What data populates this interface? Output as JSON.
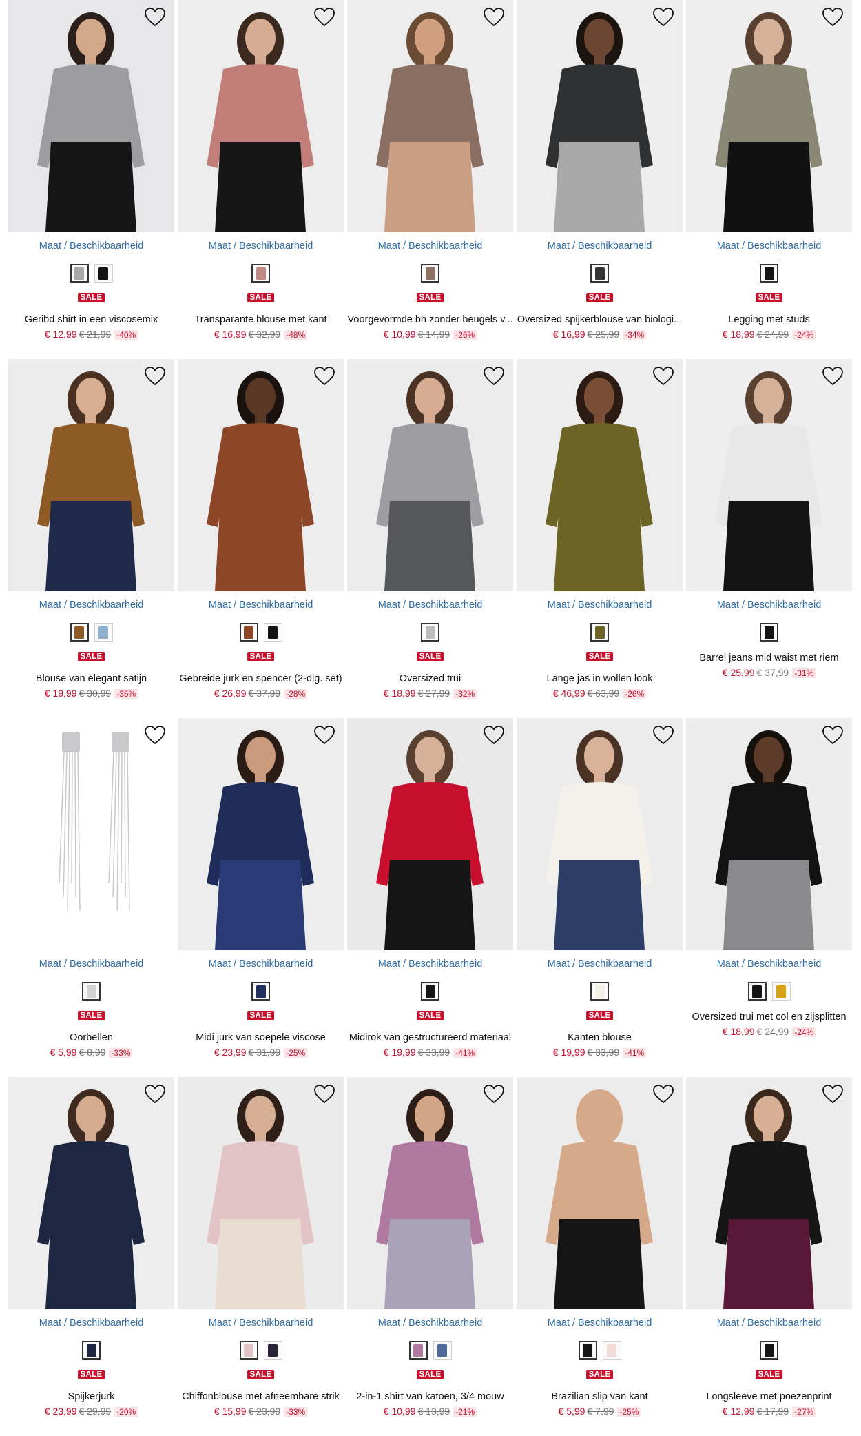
{
  "size_link_label": "Maat / Beschikbaarheid",
  "sale_label": "SALE",
  "products": [
    {
      "title": "Geribd shirt in een viscosemix",
      "price": "€ 12,99",
      "old_price": "€ 21,99",
      "discount": "-40%",
      "sale": true,
      "colors": {
        "bg": "#e7e7e9",
        "top": "#9d9da0",
        "bottom": "#151515",
        "skin": "#d2a88a",
        "hair": "#2a1f1a"
      },
      "swatches": [
        "#a9a9ab",
        "#141414"
      ]
    },
    {
      "title": "Transparante blouse met kant",
      "price": "€ 16,99",
      "old_price": "€ 32,99",
      "discount": "-48%",
      "sale": true,
      "colors": {
        "bg": "#ededed",
        "top": "#c27f7a",
        "bottom": "#161616",
        "skin": "#d6ad92",
        "hair": "#3b281e"
      },
      "swatches": [
        "#c38a83"
      ]
    },
    {
      "title": "Voorgevormde bh zonder beugels v...",
      "price": "€ 10,99",
      "old_price": "€ 14,99",
      "discount": "-26%",
      "sale": true,
      "colors": {
        "bg": "#ededed",
        "top": "#8b6e62",
        "bottom": "#c99e82",
        "skin": "#cf9f80",
        "hair": "#6a4a33"
      },
      "swatches": [
        "#8f7266"
      ]
    },
    {
      "title": "Oversized spijkerblouse van biologi...",
      "price": "€ 16,99",
      "old_price": "€ 25,99",
      "discount": "-34%",
      "sale": true,
      "colors": {
        "bg": "#ededed",
        "top": "#2f3032",
        "bottom": "#a8a8a8",
        "skin": "#6a4633",
        "hair": "#1c140f"
      },
      "swatches": [
        "#333436"
      ]
    },
    {
      "title": "Legging met studs",
      "price": "€ 18,99",
      "old_price": "€ 24,99",
      "discount": "-24%",
      "sale": true,
      "colors": {
        "bg": "#eeeeee",
        "top": "#8a8775",
        "bottom": "#111111",
        "skin": "#d6b199",
        "hair": "#5a4030"
      },
      "swatches": [
        "#151515"
      ]
    },
    {
      "title": "Blouse van elegant satijn",
      "price": "€ 19,99",
      "old_price": "€ 30,99",
      "discount": "-35%",
      "sale": true,
      "colors": {
        "bg": "#ececec",
        "top": "#8e5a26",
        "bottom": "#1f2a4a",
        "skin": "#d8ae92",
        "hair": "#4a3020"
      },
      "swatches": [
        "#8e5a26",
        "#8fb0cc"
      ]
    },
    {
      "title": "Gebreide jurk en spencer (2-dlg. set)",
      "price": "€ 26,99",
      "old_price": "€ 37,99",
      "discount": "-28%",
      "sale": true,
      "colors": {
        "bg": "#ededed",
        "top": "#8e4628",
        "bottom": "#8e4628",
        "skin": "#5a3826",
        "hair": "#1a120e"
      },
      "swatches": [
        "#8e4628",
        "#141414"
      ]
    },
    {
      "title": "Oversized trui",
      "price": "€ 18,99",
      "old_price": "€ 27,99",
      "discount": "-32%",
      "sale": true,
      "colors": {
        "bg": "#ececec",
        "top": "#9e9ea2",
        "bottom": "#55575a",
        "skin": "#d6ad92",
        "hair": "#4a3224"
      },
      "swatches": [
        "#bdbdbf"
      ]
    },
    {
      "title": "Lange jas in wollen look",
      "price": "€ 46,99",
      "old_price": "€ 63,99",
      "discount": "-26%",
      "sale": true,
      "colors": {
        "bg": "#ededed",
        "top": "#6b6424",
        "bottom": "#6b6424",
        "skin": "#7a4d36",
        "hair": "#2b1b12"
      },
      "swatches": [
        "#6b6424"
      ]
    },
    {
      "title": "Barrel jeans mid waist met riem",
      "price": "€ 25,99",
      "old_price": "€ 37,99",
      "discount": "-31%",
      "sale": false,
      "colors": {
        "bg": "#eeeeee",
        "top": "#e8e8e8",
        "bottom": "#141414",
        "skin": "#d6b199",
        "hair": "#5a4030"
      },
      "swatches": [
        "#141414"
      ]
    },
    {
      "title": "Oorbellen",
      "price": "€ 5,99",
      "old_price": "€ 8,99",
      "discount": "-33%",
      "sale": true,
      "colors": {
        "bg": "#ffffff",
        "top": "#c9c9cc",
        "bottom": "#c9c9cc",
        "skin": "#ffffff",
        "hair": "#ffffff"
      },
      "swatches": [
        "#d3d3d5"
      ]
    },
    {
      "title": "Midi jurk van soepele viscose",
      "price": "€ 23,99",
      "old_price": "€ 31,99",
      "discount": "-25%",
      "sale": true,
      "colors": {
        "bg": "#ededed",
        "top": "#1f2c5a",
        "bottom": "#2a3a74",
        "skin": "#c99a7c",
        "hair": "#2a1b14"
      },
      "swatches": [
        "#22305e"
      ]
    },
    {
      "title": "Midirok van gestructureerd materiaal",
      "price": "€ 19,99",
      "old_price": "€ 33,99",
      "discount": "-41%",
      "sale": true,
      "colors": {
        "bg": "#e9e9e9",
        "top": "#c8102e",
        "bottom": "#151515",
        "skin": "#d6b199",
        "hair": "#5a4030"
      },
      "swatches": [
        "#151515"
      ]
    },
    {
      "title": "Kanten blouse",
      "price": "€ 19,99",
      "old_price": "€ 33,99",
      "discount": "-41%",
      "sale": true,
      "colors": {
        "bg": "#ececec",
        "top": "#f4f1ea",
        "bottom": "#2c3e66",
        "skin": "#d8b39a",
        "hair": "#4a3324"
      },
      "swatches": [
        "#f3f0e8"
      ]
    },
    {
      "title": "Oversized trui met col en zijsplitten",
      "price": "€ 18,99",
      "old_price": "€ 24,99",
      "discount": "-24%",
      "sale": false,
      "colors": {
        "bg": "#ececec",
        "top": "#131313",
        "bottom": "#8a8a8c",
        "skin": "#5d3b2a",
        "hair": "#16100c"
      },
      "swatches": [
        "#131313",
        "#d6a212"
      ]
    },
    {
      "title": "Spijkerjurk",
      "price": "€ 23,99",
      "old_price": "€ 29,99",
      "discount": "-20%",
      "sale": true,
      "colors": {
        "bg": "#ededed",
        "top": "#1e2742",
        "bottom": "#1e2742",
        "skin": "#d4ab8f",
        "hair": "#3e2a1e"
      },
      "swatches": [
        "#1e2742"
      ]
    },
    {
      "title": "Chiffonblouse met afneembare strik",
      "price": "€ 15,99",
      "old_price": "€ 23,99",
      "discount": "-33%",
      "sale": true,
      "colors": {
        "bg": "#ebebeb",
        "top": "#e3c4c6",
        "bottom": "#e8ddd0",
        "skin": "#d6ae94",
        "hair": "#2e2018"
      },
      "swatches": [
        "#e3c4c6",
        "#2a2236"
      ]
    },
    {
      "title": "2-in-1 shirt van katoen, 3/4 mouw",
      "price": "€ 10,99",
      "old_price": "€ 13,99",
      "discount": "-21%",
      "sale": true,
      "colors": {
        "bg": "#ececec",
        "top": "#b07aa0",
        "bottom": "#a9a2b8",
        "skin": "#d3a587",
        "hair": "#2c1e16"
      },
      "swatches": [
        "#b07aa0",
        "#4f6a9a"
      ]
    },
    {
      "title": "Brazilian slip van kant",
      "price": "€ 5,99",
      "old_price": "€ 7,99",
      "discount": "-25%",
      "sale": true,
      "colors": {
        "bg": "#ececec",
        "top": "#d5a989",
        "bottom": "#151515",
        "skin": "#d5a989",
        "hair": "#d5a989"
      },
      "swatches": [
        "#151515",
        "#f1dcd8"
      ]
    },
    {
      "title": "Longsleeve met poezenprint",
      "price": "€ 12,99",
      "old_price": "€ 17,99",
      "discount": "-27%",
      "sale": true,
      "colors": {
        "bg": "#ececec",
        "top": "#151515",
        "bottom": "#5a1838",
        "skin": "#d6ae94",
        "hair": "#3a281d"
      },
      "swatches": [
        "#151515"
      ]
    }
  ]
}
